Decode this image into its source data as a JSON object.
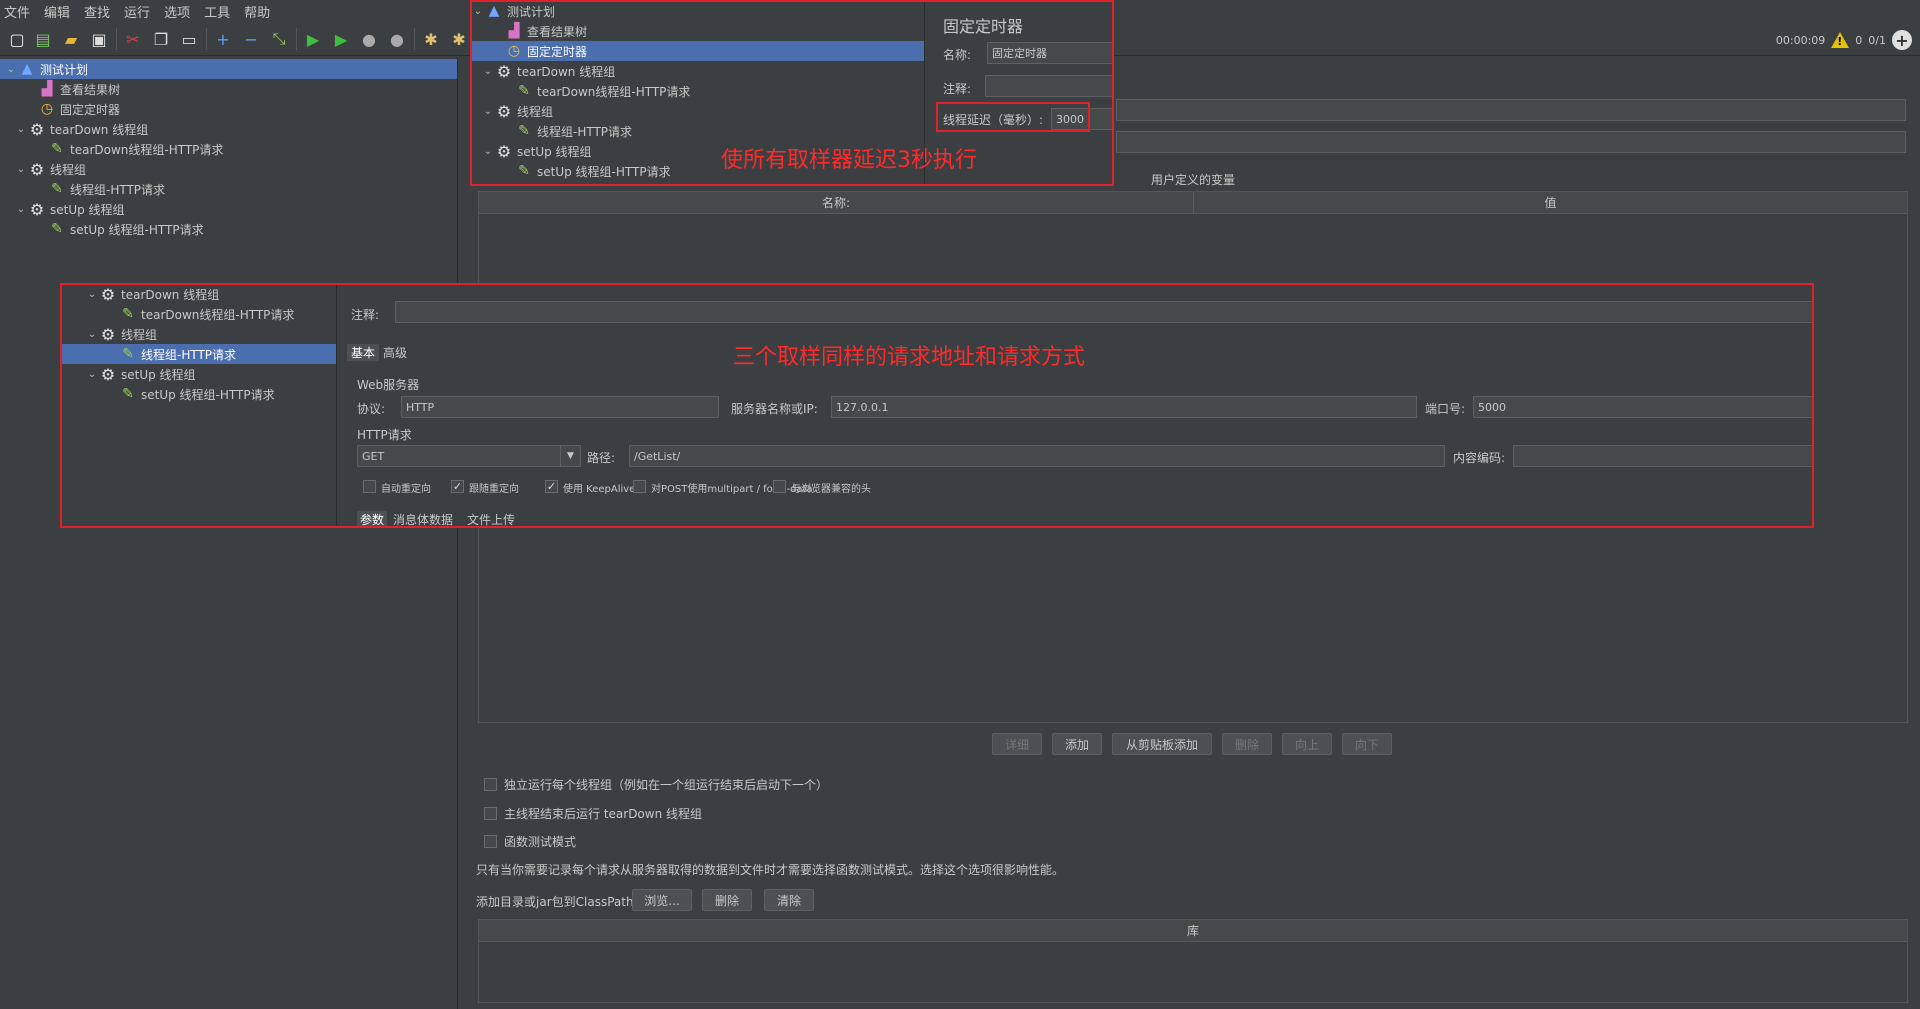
{
  "menu": [
    "文件",
    "编辑",
    "查找",
    "运行",
    "选项",
    "工具",
    "帮助"
  ],
  "status": {
    "time": "00:00:09",
    "warnings": "0",
    "threads": "0/1"
  },
  "main_tree": [
    {
      "label": "测试计划",
      "icon": "plan-icon",
      "indent": 0,
      "twisty": "v",
      "selected": true
    },
    {
      "label": "查看结果树",
      "icon": "chart-icon",
      "indent": 2,
      "twisty": "",
      "selected": false
    },
    {
      "label": "固定定时器",
      "icon": "timer-icon",
      "indent": 2,
      "twisty": "",
      "selected": false
    },
    {
      "label": "tearDown 线程组",
      "icon": "gear-icon",
      "indent": 1,
      "twisty": "v",
      "selected": false
    },
    {
      "label": "tearDown线程组-HTTP请求",
      "icon": "pen-icon",
      "indent": 3,
      "twisty": "",
      "selected": false
    },
    {
      "label": "线程组",
      "icon": "gear-icon",
      "indent": 1,
      "twisty": "v",
      "selected": false
    },
    {
      "label": "线程组-HTTP请求",
      "icon": "pen-icon",
      "indent": 3,
      "twisty": "",
      "selected": false
    },
    {
      "label": "setUp 线程组",
      "icon": "gear-icon",
      "indent": 1,
      "twisty": "v",
      "selected": false
    },
    {
      "label": "setUp 线程组-HTTP请求",
      "icon": "pen-icon",
      "indent": 3,
      "twisty": "",
      "selected": false
    }
  ],
  "timer_popup": {
    "tree": [
      {
        "label": "测试计划",
        "icon": "plan-icon",
        "indent": 0,
        "twisty": "v",
        "selected": false
      },
      {
        "label": "查看结果树",
        "icon": "chart-icon",
        "indent": 2,
        "twisty": "",
        "selected": false
      },
      {
        "label": "固定定时器",
        "icon": "timer-icon",
        "indent": 2,
        "twisty": "",
        "selected": true
      },
      {
        "label": "tearDown 线程组",
        "icon": "gear-icon",
        "indent": 1,
        "twisty": "v",
        "selected": false
      },
      {
        "label": "tearDown线程组-HTTP请求",
        "icon": "pen-icon",
        "indent": 3,
        "twisty": "",
        "selected": false
      },
      {
        "label": "线程组",
        "icon": "gear-icon",
        "indent": 1,
        "twisty": "v",
        "selected": false
      },
      {
        "label": "线程组-HTTP请求",
        "icon": "pen-icon",
        "indent": 3,
        "twisty": "",
        "selected": false
      },
      {
        "label": "setUp 线程组",
        "icon": "gear-icon",
        "indent": 1,
        "twisty": "v",
        "selected": false
      },
      {
        "label": "setUp 线程组-HTTP请求",
        "icon": "pen-icon",
        "indent": 3,
        "twisty": "",
        "selected": false
      }
    ],
    "title": "固定定时器",
    "name_label": "名称:",
    "name_value": "固定定时器",
    "comment_label": "注释:",
    "delay_label": "线程延迟（毫秒）:",
    "delay_value": "3000",
    "annotation": "使所有取样器延迟3秒执行"
  },
  "http_popup": {
    "tree": [
      {
        "label": "tearDown 线程组",
        "icon": "gear-icon",
        "indent": 1,
        "twisty": "v",
        "selected": false
      },
      {
        "label": "tearDown线程组-HTTP请求",
        "icon": "pen-icon",
        "indent": 3,
        "twisty": "",
        "selected": false
      },
      {
        "label": "线程组",
        "icon": "gear-icon",
        "indent": 1,
        "twisty": "v",
        "selected": false
      },
      {
        "label": "线程组-HTTP请求",
        "icon": "pen-icon",
        "indent": 3,
        "twisty": "",
        "selected": true
      },
      {
        "label": "setUp 线程组",
        "icon": "gear-icon",
        "indent": 1,
        "twisty": "v",
        "selected": false
      },
      {
        "label": "setUp 线程组-HTTP请求",
        "icon": "pen-icon",
        "indent": 3,
        "twisty": "",
        "selected": false
      }
    ],
    "comment_label": "注释:",
    "tab_basic": "基本",
    "tab_advanced": "高级",
    "web_server_label": "Web服务器",
    "protocol_label": "协议:",
    "protocol_value": "HTTP",
    "server_label": "服务器名称或IP:",
    "server_value": "127.0.0.1",
    "port_label": "端口号:",
    "port_value": "5000",
    "http_request_label": "HTTP请求",
    "method_value": "GET",
    "path_label": "路径:",
    "path_value": "/GetList/",
    "encoding_label": "内容编码:",
    "checks": [
      {
        "label": "自动重定向",
        "checked": false
      },
      {
        "label": "跟随重定向",
        "checked": true
      },
      {
        "label": "使用 KeepAlive",
        "checked": true
      },
      {
        "label": "对POST使用multipart / form-data",
        "checked": false
      },
      {
        "label": "与浏览器兼容的头",
        "checked": false
      }
    ],
    "subtab_params": "参数",
    "subtab_body": "消息体数据",
    "subtab_files": "文件上传",
    "annotation": "三个取样同样的请求地址和请求方式"
  },
  "plan_panel": {
    "user_vars_title": "用户定义的变量",
    "col_name": "名称:",
    "col_value": "值",
    "buttons": [
      {
        "label": "详细",
        "enabled": false
      },
      {
        "label": "添加",
        "enabled": true
      },
      {
        "label": "从剪贴板添加",
        "enabled": true
      },
      {
        "label": "删除",
        "enabled": false
      },
      {
        "label": "向上",
        "enabled": false
      },
      {
        "label": "向下",
        "enabled": false
      }
    ],
    "opt_independent": "独立运行每个线程组（例如在一个组运行结束后启动下一个）",
    "opt_teardown": "主线程结束后运行 tearDown 线程组",
    "opt_functional": "函数测试模式",
    "functional_note": "只有当你需要记录每个请求从服务器取得的数据到文件时才需要选择函数测试模式。选择这个选项很影响性能。",
    "classpath_label": "添加目录或jar包到ClassPath",
    "browse_label": "浏览...",
    "delete_label": "删除",
    "clear_label": "清除",
    "lib_col": "库"
  },
  "colors": {
    "background": "#3c3f41",
    "selection": "#4b6eaf",
    "annotation": "#ff2a2a",
    "highlight_border": "#e0202a"
  }
}
